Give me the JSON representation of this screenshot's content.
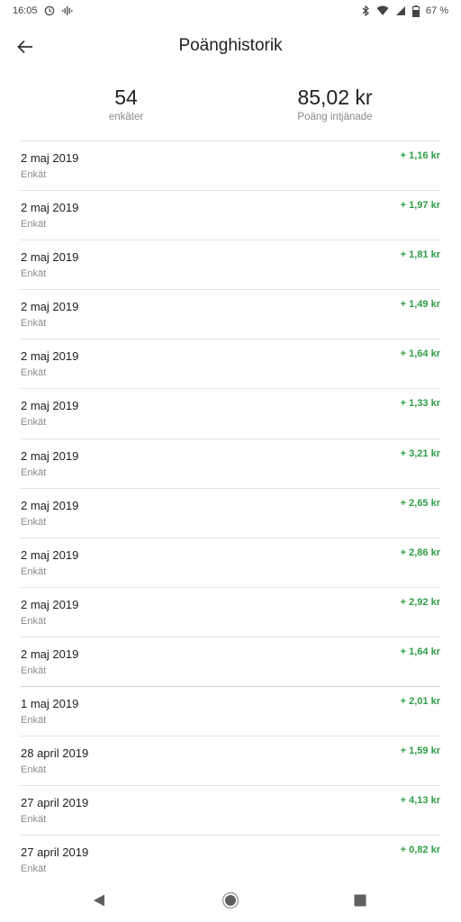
{
  "status_bar": {
    "time": "16:05",
    "battery": "67 %"
  },
  "header": {
    "title": "Poänghistorik"
  },
  "summary": {
    "surveys_value": "54",
    "surveys_label": "enkäter",
    "points_value": "85,02 kr",
    "points_label": "Poäng intjänade"
  },
  "history": [
    {
      "date": "2 maj 2019",
      "type": "Enkät",
      "amount": "+ 1,16 kr"
    },
    {
      "date": "2 maj 2019",
      "type": "Enkät",
      "amount": "+ 1,97 kr"
    },
    {
      "date": "2 maj 2019",
      "type": "Enkät",
      "amount": "+ 1,81 kr"
    },
    {
      "date": "2 maj 2019",
      "type": "Enkät",
      "amount": "+ 1,49 kr"
    },
    {
      "date": "2 maj 2019",
      "type": "Enkät",
      "amount": "+ 1,64 kr"
    },
    {
      "date": "2 maj 2019",
      "type": "Enkät",
      "amount": "+ 1,33 kr"
    },
    {
      "date": "2 maj 2019",
      "type": "Enkät",
      "amount": "+ 3,21 kr"
    },
    {
      "date": "2 maj 2019",
      "type": "Enkät",
      "amount": "+ 2,65 kr"
    },
    {
      "date": "2 maj 2019",
      "type": "Enkät",
      "amount": "+ 2,86 kr"
    },
    {
      "date": "2 maj 2019",
      "type": "Enkät",
      "amount": "+ 2,92 kr"
    },
    {
      "date": "2 maj 2019",
      "type": "Enkät",
      "amount": "+ 1,64 kr"
    },
    {
      "date": "1 maj 2019",
      "type": "Enkät",
      "amount": "+ 2,01 kr"
    },
    {
      "date": "28 april 2019",
      "type": "Enkät",
      "amount": "+ 1,59 kr"
    },
    {
      "date": "27 april 2019",
      "type": "Enkät",
      "amount": "+ 4,13 kr"
    },
    {
      "date": "27 april 2019",
      "type": "Enkät",
      "amount": "+ 0,82 kr"
    }
  ],
  "colors": {
    "amount_positive": "#2e9e45",
    "divider": "#e3e3e3"
  },
  "icons": {
    "back": "arrow-left-icon",
    "nav_back": "triangle-back-icon",
    "nav_home": "circle-home-icon",
    "nav_recents": "square-recents-icon"
  }
}
